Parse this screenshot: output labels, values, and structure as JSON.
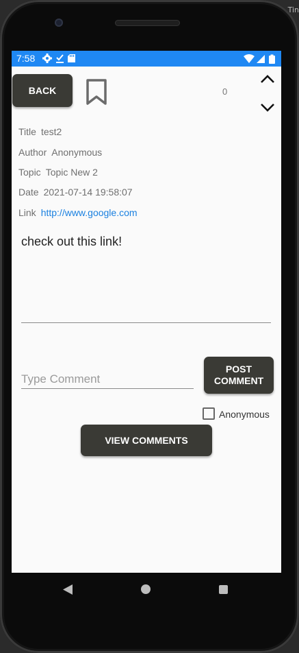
{
  "corner_tag": "Tin",
  "status": {
    "time": "7:58"
  },
  "header": {
    "back_label": "BACK",
    "vote_count": "0"
  },
  "meta": [
    {
      "label": "Title",
      "value": "test2"
    },
    {
      "label": "Author",
      "value": "Anonymous"
    },
    {
      "label": "Topic",
      "value": "Topic New 2"
    },
    {
      "label": "Date",
      "value": "2021-07-14 19:58:07"
    },
    {
      "label": "Link",
      "value": "http://www.google.com"
    }
  ],
  "post": {
    "body": "check out this link!"
  },
  "comment": {
    "placeholder": "Type Comment",
    "post_label": "POST COMMENT",
    "anonymous_label": "Anonymous",
    "anonymous_checked": false,
    "view_label": "VIEW COMMENTS"
  },
  "colors": {
    "status_bar": "#1f88f3",
    "button": "#3a3a35",
    "link": "#1a80e0"
  },
  "icons": [
    "settings-icon",
    "download-done-icon",
    "sd-card-icon",
    "wifi-icon",
    "signal-icon",
    "battery-icon",
    "bookmark-icon",
    "chevron-up-icon",
    "chevron-down-icon",
    "nav-back-icon",
    "nav-home-icon",
    "nav-recents-icon"
  ]
}
